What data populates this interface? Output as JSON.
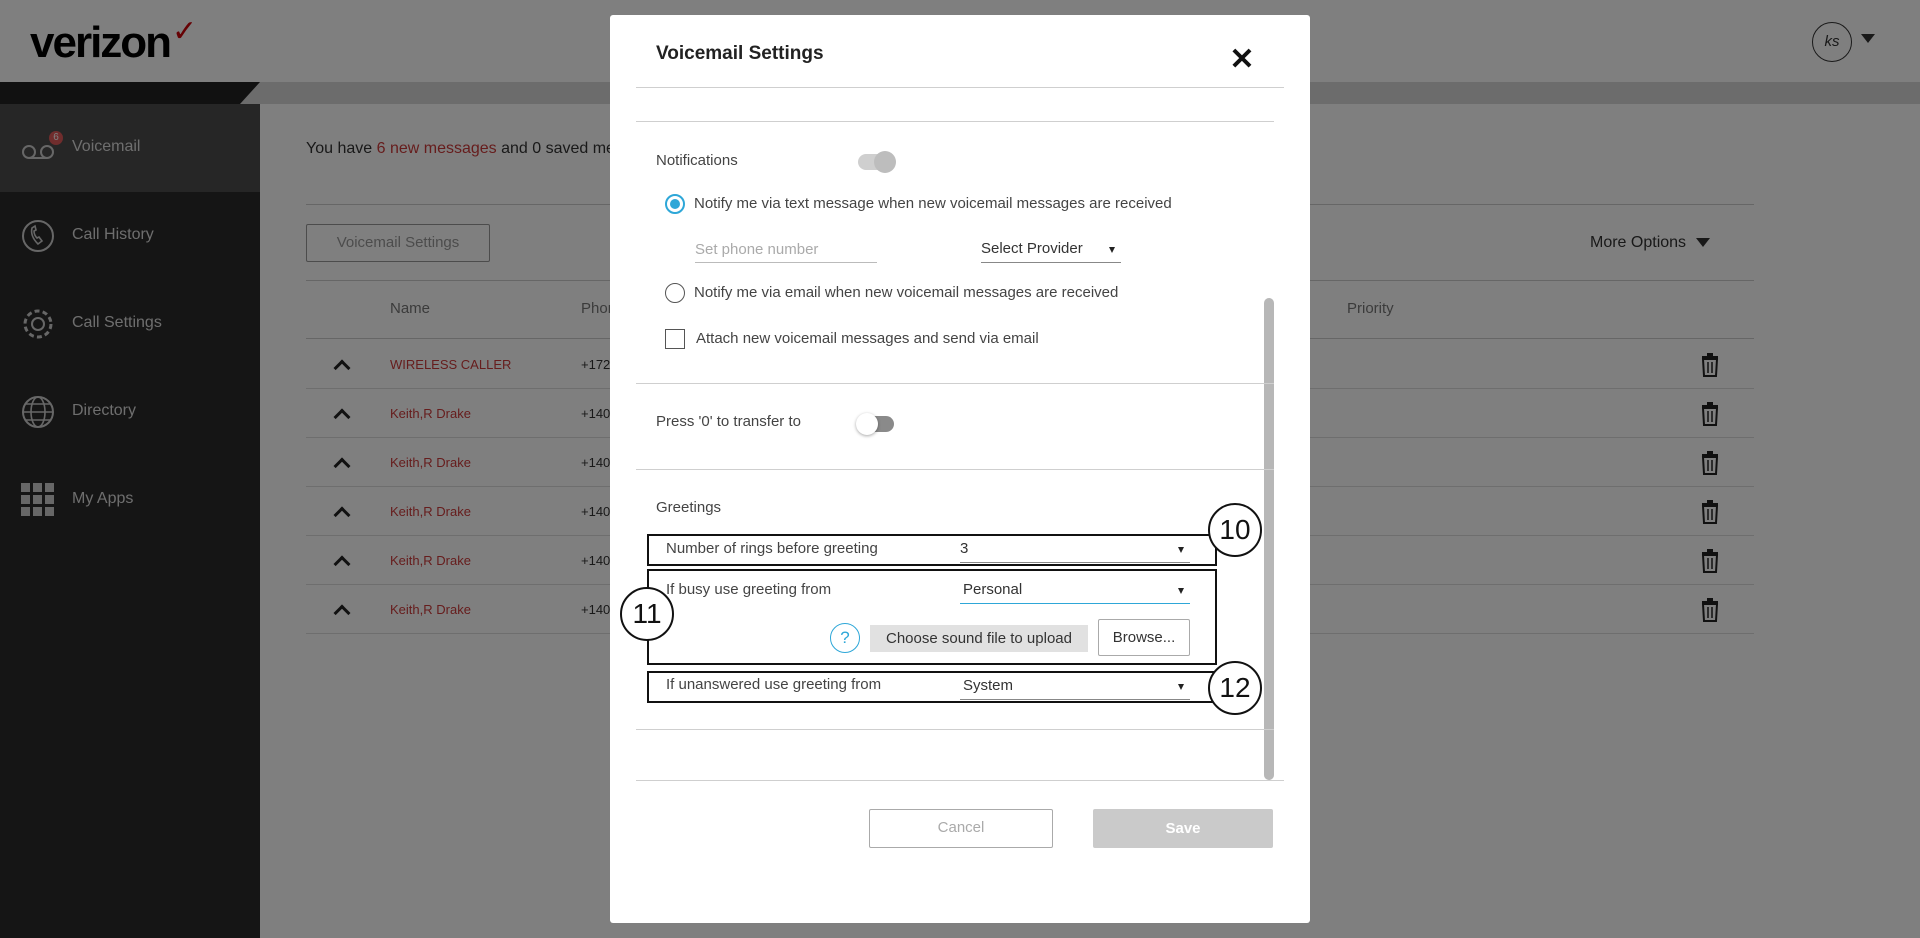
{
  "app": {
    "logo_text": "verizon",
    "logo_mark": "✓",
    "avatar_initials": "ks"
  },
  "sidebar": {
    "items": [
      {
        "label": "Voicemail",
        "icon": "voicemail-icon",
        "badge": "6",
        "active": true
      },
      {
        "label": "Call History",
        "icon": "call-history-icon"
      },
      {
        "label": "Call Settings",
        "icon": "gear-icon"
      },
      {
        "label": "Directory",
        "icon": "globe-icon"
      },
      {
        "label": "My Apps",
        "icon": "grid-icon"
      }
    ]
  },
  "main": {
    "message_prefix": "You have ",
    "new_messages": "6 new messages",
    "message_mid": " and 0 saved me",
    "voicemail_settings_button": "Voicemail Settings",
    "more_options": "More Options",
    "columns": {
      "name": "Name",
      "phone": "Phon",
      "priority": "Priority"
    },
    "rows": [
      {
        "name": "WIRELESS CALLER",
        "phone": "+172"
      },
      {
        "name": "Keith,R Drake",
        "phone": "+140"
      },
      {
        "name": "Keith,R Drake",
        "phone": "+140"
      },
      {
        "name": "Keith,R Drake",
        "phone": "+140"
      },
      {
        "name": "Keith,R Drake",
        "phone": "+140"
      },
      {
        "name": "Keith,R Drake",
        "phone": "+140"
      }
    ]
  },
  "modal": {
    "title": "Voicemail Settings",
    "close_symbol": "✕",
    "notifications_label": "Notifications",
    "notify_text_label": "Notify me via text message when new voicemail messages are received",
    "phone_placeholder": "Set phone number",
    "provider_select": "Select Provider",
    "notify_email_label": "Notify me via email when new voicemail messages are received",
    "attach_label": "Attach new voicemail messages and send via email",
    "transfer_label": "Press '0' to transfer to",
    "greetings_label": "Greetings",
    "rings_label": "Number of rings before greeting",
    "rings_value": "3",
    "busy_label": "If busy use greeting from",
    "busy_value": "Personal",
    "help_symbol": "?",
    "upload_label": "Choose sound file to upload",
    "browse_label": "Browse...",
    "unanswered_label": "If unanswered use greeting from",
    "unanswered_value": "System",
    "cancel_label": "Cancel",
    "save_label": "Save",
    "callouts": [
      "10",
      "11",
      "12"
    ]
  },
  "colors": {
    "brand_red": "#cd040b",
    "link_red": "#cd3a3a",
    "accent_blue": "#2ea7d8",
    "sidebar_bg": "#2b2b2b"
  }
}
